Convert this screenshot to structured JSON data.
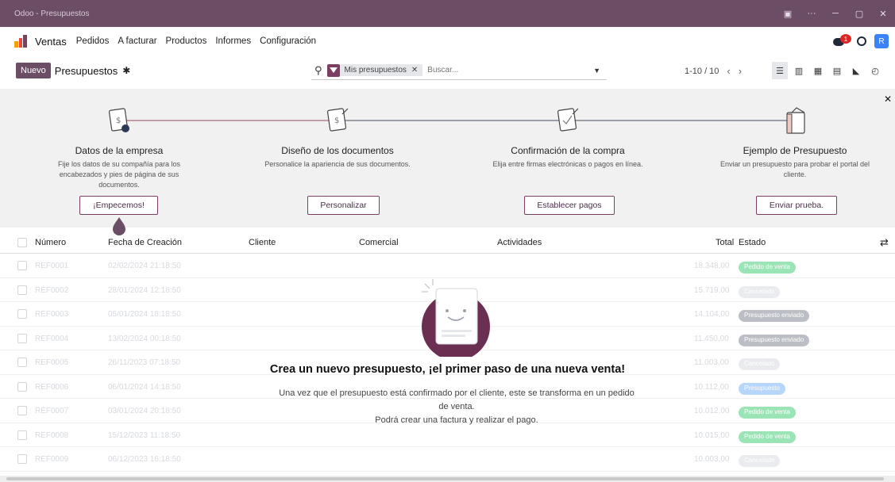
{
  "window": {
    "title": "Odoo - Presupuestos"
  },
  "menu": {
    "app": "Ventas",
    "items": [
      "Pedidos",
      "A facturar",
      "Productos",
      "Informes",
      "Configuración"
    ],
    "notifications": "1",
    "avatar": "R"
  },
  "control": {
    "new_label": "Nuevo",
    "breadcrumb": "Presupuestos",
    "facet": "Mis presupuestos",
    "search_placeholder": "Buscar...",
    "pager": "1-10 / 10"
  },
  "onboarding": {
    "steps": [
      {
        "title": "Datos de la empresa",
        "text": "Fije los datos de su compañía para los encabezados y pies de página de sus documentos.",
        "button": "¡Empecemos!"
      },
      {
        "title": "Diseño de los documentos",
        "text": "Personalice la apariencia de sus documentos.",
        "button": "Personalizar"
      },
      {
        "title": "Confirmación de la compra",
        "text": "Elija entre firmas electrónicas o pagos en línea.",
        "button": "Establecer pagos"
      },
      {
        "title": "Ejemplo de Presupuesto",
        "text": "Enviar un presupuesto para probar el portal del cliente.",
        "button": "Enviar prueba."
      }
    ]
  },
  "table": {
    "columns": [
      "Número",
      "Fecha de Creación",
      "Cliente",
      "Comercial",
      "Actividades",
      "Total",
      "Estado"
    ],
    "rows": [
      {
        "number": "REF0001",
        "date": "02/02/2024 21:18:50",
        "total": "18.348,00",
        "status": "Pedido de venta",
        "status_color": "#22c55e"
      },
      {
        "number": "REF0002",
        "date": "28/01/2024 12:18:50",
        "total": "15.719,00",
        "status": "Cancelado",
        "status_color": "#d1d5db"
      },
      {
        "number": "REF0003",
        "date": "05/01/2024 18:18:50",
        "total": "14.104,00",
        "status": "Presupuesto enviado",
        "status_color": "#6b7280"
      },
      {
        "number": "REF0004",
        "date": "13/02/2024 00:18:50",
        "total": "11.450,00",
        "status": "Presupuesto enviado",
        "status_color": "#6b7280"
      },
      {
        "number": "REF0005",
        "date": "26/11/2023 07:18:50",
        "total": "11.003,00",
        "status": "Cancelado",
        "status_color": "#d1d5db"
      },
      {
        "number": "REF0006",
        "date": "06/01/2024 14:18:50",
        "total": "10.112,00",
        "status": "Presupuesto",
        "status_color": "#60a5fa"
      },
      {
        "number": "REF0007",
        "date": "03/01/2024 20:18:50",
        "total": "10.012,00",
        "status": "Pedido de venta",
        "status_color": "#22c55e"
      },
      {
        "number": "REF0008",
        "date": "15/12/2023 11:18:50",
        "total": "10.015,00",
        "status": "Pedido de venta",
        "status_color": "#22c55e"
      },
      {
        "number": "REF0009",
        "date": "06/12/2023 16:18:50",
        "total": "10.003,00",
        "status": "Cancelado",
        "status_color": "#d1d5db"
      }
    ]
  },
  "empty": {
    "title": "Crea un nuevo presupuesto, ¡el primer paso de una nueva venta!",
    "line1": "Una vez que el presupuesto está confirmado por el cliente, este se transforma en un pedido de venta.",
    "line2": "Podrá crear una factura y realizar el pago."
  },
  "colors": {
    "brand": "#6b4e66",
    "accent": "#7c3f63"
  }
}
